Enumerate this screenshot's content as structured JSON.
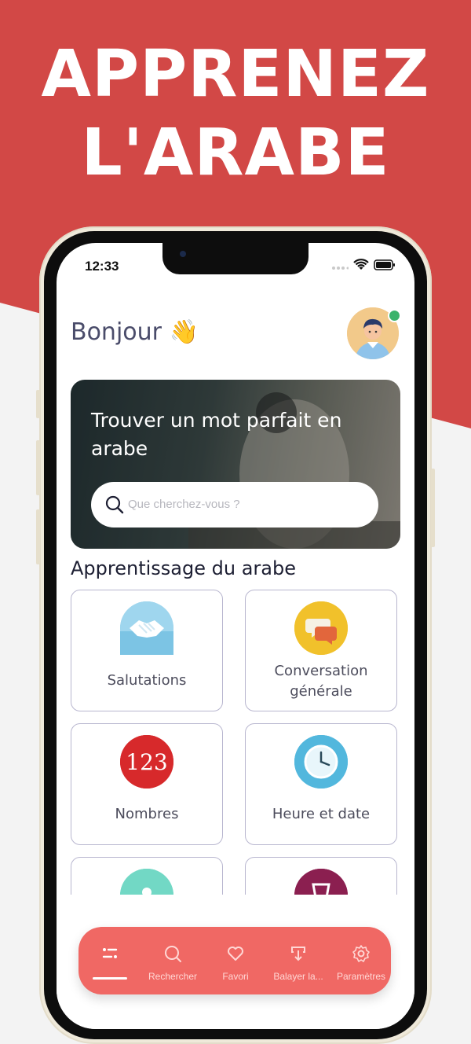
{
  "colors": {
    "brand_red": "#d24846",
    "nav_red": "#f06864",
    "online": "#3bb36b"
  },
  "promo": {
    "line1": "APPRENEZ",
    "line2": "L'ARABE"
  },
  "status_bar": {
    "time": "12:33"
  },
  "header": {
    "greeting": "Bonjour 👋"
  },
  "hero": {
    "title": "Trouver un mot parfait en arabe",
    "search_placeholder": "Que cherchez-vous ?"
  },
  "section": {
    "title": "Apprentissage du arabe"
  },
  "categories": [
    {
      "label": "Salutations",
      "icon": "handshake-icon"
    },
    {
      "label": "Conversation générale",
      "icon": "chat-bubbles-icon"
    },
    {
      "label": "Nombres",
      "icon": "numbers-123-icon"
    },
    {
      "label": "Heure et date",
      "icon": "clock-icon"
    },
    {
      "label": "",
      "icon": "location-pin-icon"
    },
    {
      "label": "",
      "icon": "glass-icon"
    }
  ],
  "nav": [
    {
      "label": "",
      "icon": "home-list-icon",
      "active": true
    },
    {
      "label": "Rechercher",
      "icon": "search-icon"
    },
    {
      "label": "Favori",
      "icon": "heart-icon"
    },
    {
      "label": "Balayer la...",
      "icon": "download-swipe-icon"
    },
    {
      "label": "Paramètres",
      "icon": "gear-icon"
    }
  ]
}
